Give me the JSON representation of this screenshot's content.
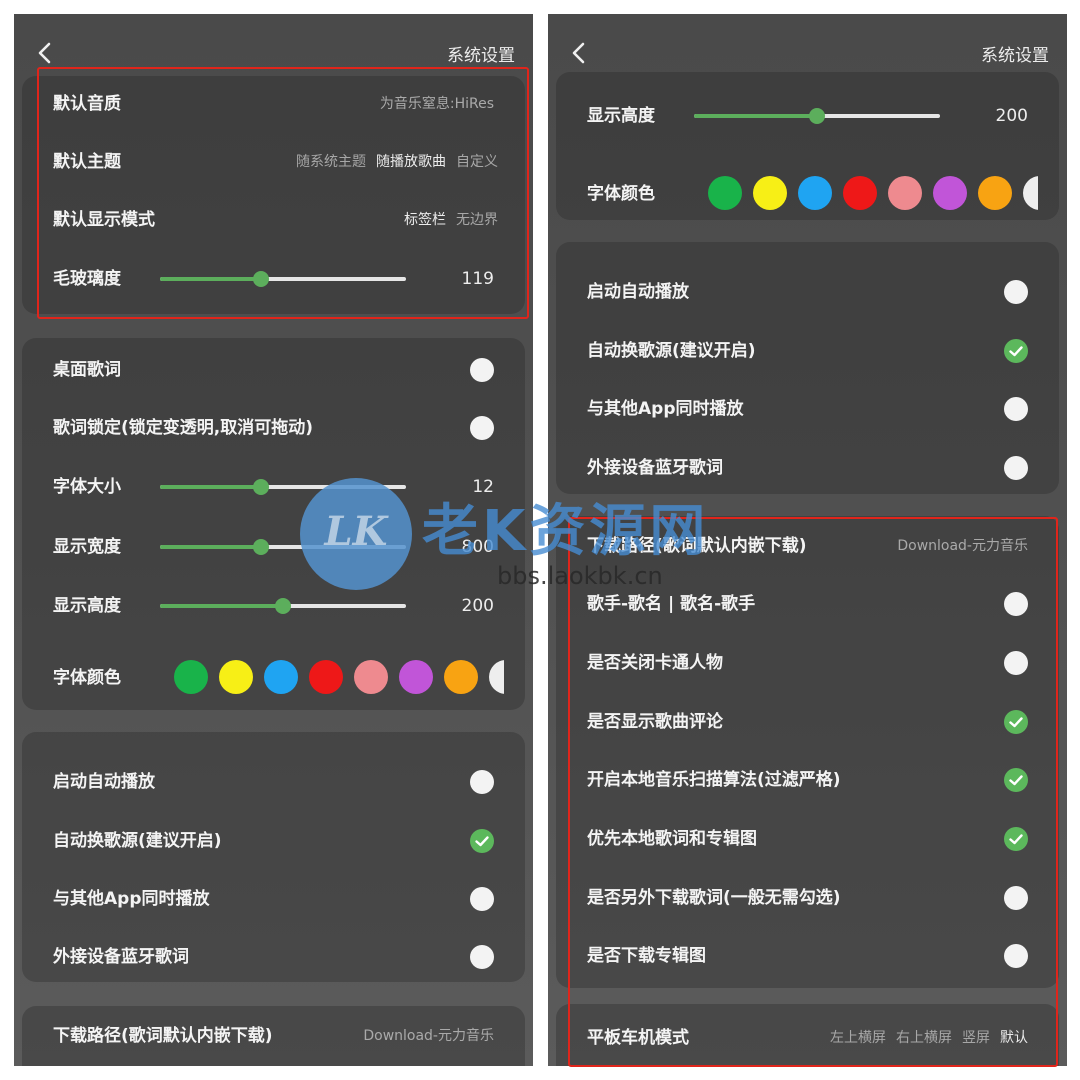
{
  "colors": {
    "accent": "#5cae5c",
    "highlight_box": "#e0251b",
    "swatches": [
      "#19b34a",
      "#f7ef16",
      "#1fa4f2",
      "#ee1818",
      "#ee8a8f",
      "#c155d8",
      "#f8a312",
      "#eeeeee"
    ]
  },
  "icons": {
    "back": "back-chevron-icon",
    "checked": "check-icon"
  },
  "left": {
    "title": "系统设置",
    "quality": {
      "label": "默认音质",
      "value": "为音乐窒息:HiRes"
    },
    "theme": {
      "label": "默认主题",
      "options": [
        "随系统主题",
        "随播放歌曲",
        "自定义"
      ],
      "selected": "随播放歌曲"
    },
    "display_mode": {
      "label": "默认显示模式",
      "options": [
        "标签栏",
        "无边界"
      ],
      "selected": "标签栏"
    },
    "frost": {
      "label": "毛玻璃度",
      "value": "119",
      "level": 0.41
    },
    "desktop_lyrics": {
      "label": "桌面歌词",
      "checked": false
    },
    "lyrics_lock": {
      "label": "歌词锁定(锁定变透明,取消可拖动)",
      "checked": false
    },
    "font_size": {
      "label": "字体大小",
      "value": "12",
      "level": 0.41
    },
    "display_width": {
      "label": "显示宽度",
      "value": "800",
      "level": 0.41
    },
    "display_height": {
      "label": "显示高度",
      "value": "200",
      "level": 0.5
    },
    "font_color": {
      "label": "字体颜色"
    },
    "auto_play": {
      "label": "启动自动播放",
      "checked": false
    },
    "auto_switch": {
      "label": "自动换歌源(建议开启)",
      "checked": true
    },
    "play_with_apps": {
      "label": "与其他App同时播放",
      "checked": false
    },
    "bt_lyrics": {
      "label": "外接设备蓝牙歌词",
      "checked": false
    },
    "download_path": {
      "label": "下载路径(歌词默认内嵌下载)",
      "value": "Download-元力音乐"
    }
  },
  "right": {
    "title": "系统设置",
    "display_height": {
      "label": "显示高度",
      "value": "200",
      "level": 0.5
    },
    "font_color": {
      "label": "字体颜色"
    },
    "auto_play": {
      "label": "启动自动播放",
      "checked": false
    },
    "auto_switch": {
      "label": "自动换歌源(建议开启)",
      "checked": true
    },
    "play_with_apps": {
      "label": "与其他App同时播放",
      "checked": false
    },
    "bt_lyrics": {
      "label": "外接设备蓝牙歌词",
      "checked": false
    },
    "download_path": {
      "label": "下载路径(歌词默认内嵌下载)",
      "value": "Download-元力音乐"
    },
    "singer_song": {
      "label": "歌手-歌名 | 歌名-歌手",
      "checked": false
    },
    "close_cartoon": {
      "label": "是否关闭卡通人物",
      "checked": false
    },
    "show_comments": {
      "label": "是否显示歌曲评论",
      "checked": true
    },
    "scan_algorithm": {
      "label": "开启本地音乐扫描算法(过滤严格)",
      "checked": true
    },
    "local_priority": {
      "label": "优先本地歌词和专辑图",
      "checked": true
    },
    "extra_lyrics": {
      "label": "是否另外下载歌词(一般无需勾选)",
      "checked": false
    },
    "download_cover": {
      "label": "是否下载专辑图",
      "checked": false
    },
    "tablet_mode": {
      "label": "平板车机模式",
      "options": [
        "左上横屏",
        "右上横屏",
        "竖屏",
        "默认"
      ],
      "selected": "默认"
    }
  },
  "watermark": {
    "badge": "LK",
    "title": "老K资源网",
    "url": "bbs.laokbk.cn"
  }
}
